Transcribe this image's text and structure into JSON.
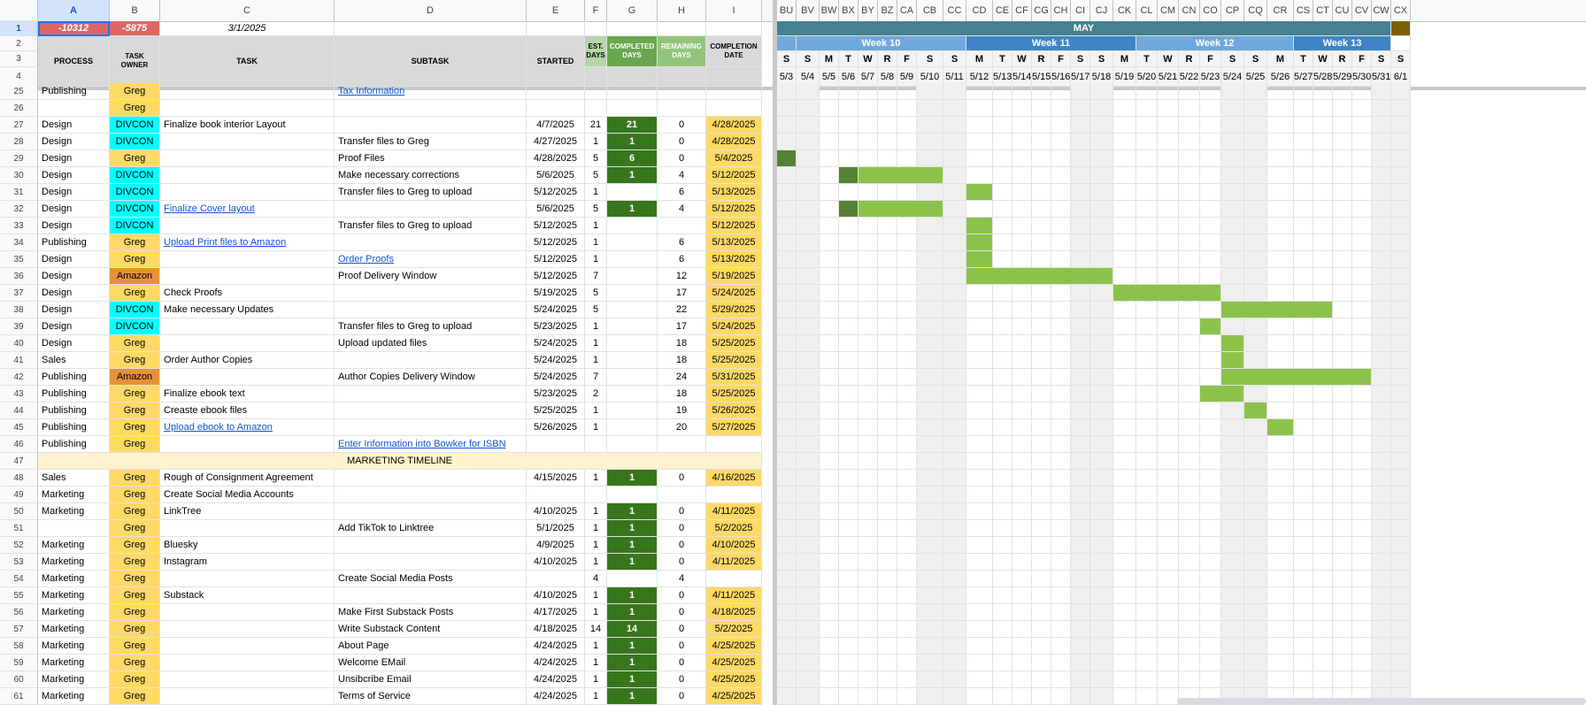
{
  "colors": {
    "headerBg": "#d9d9d9",
    "redNeg": "#e06666",
    "owner_Greg": "#ffd966",
    "owner_DIVCON": "#00ffff",
    "owner_Amazon": "#e69138",
    "completedDark": "#38761d",
    "estLight": "#b6d7a8",
    "completedHdr": "#6aa84f",
    "remainingHdr": "#93c47d",
    "completionDate": "#ffd966",
    "gantt": "#8bc34a",
    "ganttDark": "#548235",
    "weekendCol": "#efefef",
    "mayBar": "#45818e",
    "weekBand1": "#6fa8dc",
    "weekBand2": "#3d85c6",
    "mktg": "#fff2cc"
  },
  "left_columns": [
    "A",
    "B",
    "C",
    "D",
    "E",
    "F",
    "G",
    "H",
    "I"
  ],
  "gantt_columns": [
    "BU",
    "BV",
    "BW",
    "BX",
    "BY",
    "BZ",
    "CA",
    "CB",
    "CC",
    "CD",
    "CE",
    "CF",
    "CG",
    "CH",
    "CI",
    "CJ",
    "CK",
    "CL",
    "CM",
    "CN",
    "CO",
    "CP",
    "CQ",
    "CR",
    "CS",
    "CT",
    "CU",
    "CV",
    "CW",
    "CX"
  ],
  "top_row1": {
    "a": "-10312",
    "b": "-5875",
    "c": "3/1/2025"
  },
  "headers": {
    "process": "PROCESS",
    "owner": "TASK OWNER",
    "task": "TASK",
    "subtask": "SUBTASK",
    "started": "STARTED",
    "est": "EST. DAYS",
    "completed": "COMPLETED DAYS",
    "remaining": "REMAINING DAYS",
    "completion": "COMPLETION DATE"
  },
  "month_label": "MAY",
  "weeks": [
    {
      "label": "Week 10"
    },
    {
      "label": "Week 11"
    },
    {
      "label": "Week 12"
    },
    {
      "label": "Week 13"
    }
  ],
  "day_letters": [
    "S",
    "S",
    "M",
    "T",
    "W",
    "R",
    "F",
    "S",
    "S",
    "M",
    "T",
    "W",
    "R",
    "F",
    "S",
    "S",
    "M",
    "T",
    "W",
    "R",
    "F",
    "S",
    "S",
    "M",
    "T",
    "W",
    "R",
    "F",
    "S",
    "S"
  ],
  "dates": [
    "5/3",
    "5/4",
    "5/5",
    "5/6",
    "5/7",
    "5/8",
    "5/9",
    "5/10",
    "5/11",
    "5/12",
    "5/13",
    "5/14",
    "5/15",
    "5/16",
    "5/17",
    "5/18",
    "5/19",
    "5/20",
    "5/21",
    "5/22",
    "5/23",
    "5/24",
    "5/25",
    "5/26",
    "5/27",
    "5/28",
    "5/29",
    "5/30",
    "5/31",
    "6/1"
  ],
  "row_numbers_header": [
    "1",
    "2",
    "3",
    "4"
  ],
  "rows": [
    {
      "n": "25",
      "process": "Publishing",
      "owner": "Greg",
      "task": "",
      "subtask": "Tax Information",
      "subtask_link": true,
      "started": "",
      "est": "",
      "comp": "",
      "rem": "",
      "cdate": "",
      "gantt": []
    },
    {
      "n": "26",
      "process": "",
      "owner": "Greg",
      "task": "",
      "subtask": "",
      "started": "",
      "est": "",
      "comp": "",
      "rem": "",
      "cdate": "",
      "gantt": []
    },
    {
      "n": "27",
      "process": "Design",
      "owner": "DIVCON",
      "task": "Finalize book interior Layout",
      "subtask": "",
      "started": "4/7/2025",
      "est": "21",
      "comp": "21",
      "rem": "0",
      "cdate": "4/28/2025",
      "gantt": []
    },
    {
      "n": "28",
      "process": "Design",
      "owner": "DIVCON",
      "task": "",
      "subtask": "Transfer files to Greg",
      "started": "4/27/2025",
      "est": "1",
      "comp": "1",
      "rem": "0",
      "cdate": "4/28/2025",
      "gantt": []
    },
    {
      "n": "29",
      "process": "Design",
      "owner": "Greg",
      "task": "",
      "subtask": "Proof Files",
      "started": "4/28/2025",
      "est": "5",
      "comp": "6",
      "rem": "0",
      "cdate": "5/4/2025",
      "gantt": [
        [
          "0",
          "0",
          "d"
        ]
      ]
    },
    {
      "n": "30",
      "process": "Design",
      "owner": "DIVCON",
      "task": "",
      "subtask": "Make necessary corrections",
      "started": "5/6/2025",
      "est": "5",
      "comp": "1",
      "rem": "4",
      "cdate": "5/12/2025",
      "gantt": [
        [
          "3",
          "3",
          "d"
        ],
        [
          "4",
          "7",
          "g"
        ]
      ]
    },
    {
      "n": "31",
      "process": "Design",
      "owner": "DIVCON",
      "task": "",
      "subtask": "Transfer files to Greg to upload",
      "started": "5/12/2025",
      "est": "1",
      "comp": "",
      "rem": "6",
      "cdate": "5/13/2025",
      "gantt": [
        [
          "9",
          "9",
          "g"
        ]
      ]
    },
    {
      "n": "32",
      "process": "Design",
      "owner": "DIVCON",
      "task": "Finalize Cover layout",
      "task_link": true,
      "subtask": "",
      "started": "5/6/2025",
      "est": "5",
      "comp": "1",
      "rem": "4",
      "cdate": "5/12/2025",
      "gantt": [
        [
          "3",
          "3",
          "d"
        ],
        [
          "4",
          "7",
          "g"
        ]
      ]
    },
    {
      "n": "33",
      "process": "Design",
      "owner": "DIVCON",
      "task": "",
      "subtask": "Transfer files to Greg to upload",
      "started": "5/12/2025",
      "est": "1",
      "comp": "",
      "rem": "",
      "cdate": "5/12/2025",
      "gantt": [
        [
          "9",
          "9",
          "g"
        ]
      ]
    },
    {
      "n": "34",
      "process": "Publishing",
      "owner": "Greg",
      "task": "Upload Print files to Amazon",
      "task_link": true,
      "subtask": "",
      "started": "5/12/2025",
      "est": "1",
      "comp": "",
      "rem": "6",
      "cdate": "5/13/2025",
      "gantt": [
        [
          "9",
          "9",
          "g"
        ]
      ]
    },
    {
      "n": "35",
      "process": "Design",
      "owner": "Greg",
      "task": "",
      "subtask": "Order Proofs",
      "subtask_link": true,
      "started": "5/12/2025",
      "est": "1",
      "comp": "",
      "rem": "6",
      "cdate": "5/13/2025",
      "gantt": [
        [
          "9",
          "9",
          "g"
        ]
      ]
    },
    {
      "n": "36",
      "process": "Design",
      "owner": "Amazon",
      "task": "",
      "subtask": "Proof Delivery Window",
      "started": "5/12/2025",
      "est": "7",
      "comp": "",
      "rem": "12",
      "cdate": "5/19/2025",
      "gantt": [
        [
          "9",
          "15",
          "g"
        ]
      ]
    },
    {
      "n": "37",
      "process": "Design",
      "owner": "Greg",
      "task": "Check Proofs",
      "subtask": "",
      "started": "5/19/2025",
      "est": "5",
      "comp": "",
      "rem": "17",
      "cdate": "5/24/2025",
      "gantt": [
        [
          "16",
          "20",
          "g"
        ]
      ]
    },
    {
      "n": "38",
      "process": "Design",
      "owner": "DIVCON",
      "task": "Make necessary Updates",
      "subtask": "",
      "started": "5/24/2025",
      "est": "5",
      "comp": "",
      "rem": "22",
      "cdate": "5/29/2025",
      "gantt": [
        [
          "21",
          "25",
          "g"
        ]
      ]
    },
    {
      "n": "39",
      "process": "Design",
      "owner": "DIVCON",
      "task": "",
      "subtask": "Transfer files to Greg to upload",
      "started": "5/23/2025",
      "est": "1",
      "comp": "",
      "rem": "17",
      "cdate": "5/24/2025",
      "gantt": [
        [
          "20",
          "20",
          "g"
        ]
      ]
    },
    {
      "n": "40",
      "process": "Design",
      "owner": "Greg",
      "task": "",
      "subtask": "Upload updated files",
      "started": "5/24/2025",
      "est": "1",
      "comp": "",
      "rem": "18",
      "cdate": "5/25/2025",
      "gantt": [
        [
          "21",
          "21",
          "g"
        ]
      ]
    },
    {
      "n": "41",
      "process": "Sales",
      "owner": "Greg",
      "task": "Order Author Copies",
      "subtask": "",
      "started": "5/24/2025",
      "est": "1",
      "comp": "",
      "rem": "18",
      "cdate": "5/25/2025",
      "gantt": [
        [
          "21",
          "21",
          "g"
        ]
      ]
    },
    {
      "n": "42",
      "process": "Publishing",
      "owner": "Amazon",
      "task": "",
      "subtask": "Author Copies Delivery Window",
      "started": "5/24/2025",
      "est": "7",
      "comp": "",
      "rem": "24",
      "cdate": "5/31/2025",
      "gantt": [
        [
          "21",
          "27",
          "g"
        ]
      ]
    },
    {
      "n": "43",
      "process": "Publishing",
      "owner": "Greg",
      "task": "Finalize ebook text",
      "subtask": "",
      "started": "5/23/2025",
      "est": "2",
      "comp": "",
      "rem": "18",
      "cdate": "5/25/2025",
      "gantt": [
        [
          "20",
          "21",
          "g"
        ]
      ]
    },
    {
      "n": "44",
      "process": "Publishing",
      "owner": "Greg",
      "task": "Creaste ebook files",
      "subtask": "",
      "started": "5/25/2025",
      "est": "1",
      "comp": "",
      "rem": "19",
      "cdate": "5/26/2025",
      "gantt": [
        [
          "22",
          "22",
          "g"
        ]
      ]
    },
    {
      "n": "45",
      "process": "Publishing",
      "owner": "Greg",
      "task": "Upload ebook to Amazon",
      "task_link": true,
      "subtask": "",
      "started": "5/26/2025",
      "est": "1",
      "comp": "",
      "rem": "20",
      "cdate": "5/27/2025",
      "gantt": [
        [
          "23",
          "23",
          "g"
        ]
      ]
    },
    {
      "n": "46",
      "process": "Publishing",
      "owner": "Greg",
      "task": "",
      "subtask": "Enter Information into Bowker for ISBN",
      "subtask_link": true,
      "started": "",
      "est": "",
      "comp": "",
      "rem": "",
      "cdate": "",
      "gantt": []
    },
    {
      "n": "47",
      "section": "MARKETING TIMELINE"
    },
    {
      "n": "48",
      "process": "Sales",
      "owner": "Greg",
      "task": "Rough of Consignment Agreement",
      "subtask": "",
      "started": "4/15/2025",
      "est": "1",
      "comp": "1",
      "rem": "0",
      "cdate": "4/16/2025",
      "gantt": []
    },
    {
      "n": "49",
      "process": "Marketing",
      "owner": "Greg",
      "task": "Create Social Media Accounts",
      "subtask": "",
      "started": "",
      "est": "",
      "comp": "",
      "rem": "",
      "cdate": "",
      "gantt": []
    },
    {
      "n": "50",
      "process": "Marketing",
      "owner": "Greg",
      "task": "LinkTree",
      "subtask": "",
      "started": "4/10/2025",
      "est": "1",
      "comp": "1",
      "rem": "0",
      "cdate": "4/11/2025",
      "gantt": []
    },
    {
      "n": "51",
      "process": "",
      "owner": "Greg",
      "task": "",
      "subtask": "Add TikTok to Linktree",
      "started": "5/1/2025",
      "est": "1",
      "comp": "1",
      "rem": "0",
      "cdate": "5/2/2025",
      "gantt": []
    },
    {
      "n": "52",
      "process": "Marketing",
      "owner": "Greg",
      "task": "Bluesky",
      "subtask": "",
      "started": "4/9/2025",
      "est": "1",
      "comp": "1",
      "rem": "0",
      "cdate": "4/10/2025",
      "gantt": []
    },
    {
      "n": "53",
      "process": "Marketing",
      "owner": "Greg",
      "task": "Instagram",
      "subtask": "",
      "started": "4/10/2025",
      "est": "1",
      "comp": "1",
      "rem": "0",
      "cdate": "4/11/2025",
      "gantt": []
    },
    {
      "n": "54",
      "process": "Marketing",
      "owner": "Greg",
      "task": "",
      "subtask": "Create Social Media Posts",
      "started": "",
      "est": "4",
      "comp": "",
      "rem": "4",
      "cdate": "",
      "gantt": []
    },
    {
      "n": "55",
      "process": "Marketing",
      "owner": "Greg",
      "task": "Substack",
      "subtask": "",
      "started": "4/10/2025",
      "est": "1",
      "comp": "1",
      "rem": "0",
      "cdate": "4/11/2025",
      "gantt": []
    },
    {
      "n": "56",
      "process": "Marketing",
      "owner": "Greg",
      "task": "",
      "subtask": "Make First Substack Posts",
      "started": "4/17/2025",
      "est": "1",
      "comp": "1",
      "rem": "0",
      "cdate": "4/18/2025",
      "gantt": []
    },
    {
      "n": "57",
      "process": "Marketing",
      "owner": "Greg",
      "task": "",
      "subtask": "Write Substack Content",
      "started": "4/18/2025",
      "est": "14",
      "comp": "14",
      "rem": "0",
      "cdate": "5/2/2025",
      "gantt": []
    },
    {
      "n": "58",
      "process": "Marketing",
      "owner": "Greg",
      "task": "",
      "subtask": "About Page",
      "started": "4/24/2025",
      "est": "1",
      "comp": "1",
      "rem": "0",
      "cdate": "4/25/2025",
      "gantt": []
    },
    {
      "n": "59",
      "process": "Marketing",
      "owner": "Greg",
      "task": "",
      "subtask": "Welcome EMail",
      "started": "4/24/2025",
      "est": "1",
      "comp": "1",
      "rem": "0",
      "cdate": "4/25/2025",
      "gantt": []
    },
    {
      "n": "60",
      "process": "Marketing",
      "owner": "Greg",
      "task": "",
      "subtask": "Unsibcribe Email",
      "started": "4/24/2025",
      "est": "1",
      "comp": "1",
      "rem": "0",
      "cdate": "4/25/2025",
      "gantt": []
    },
    {
      "n": "61",
      "process": "Marketing",
      "owner": "Greg",
      "task": "",
      "subtask": "Terms of Service",
      "started": "4/24/2025",
      "est": "1",
      "comp": "1",
      "rem": "0",
      "cdate": "4/25/2025",
      "gantt": []
    }
  ]
}
